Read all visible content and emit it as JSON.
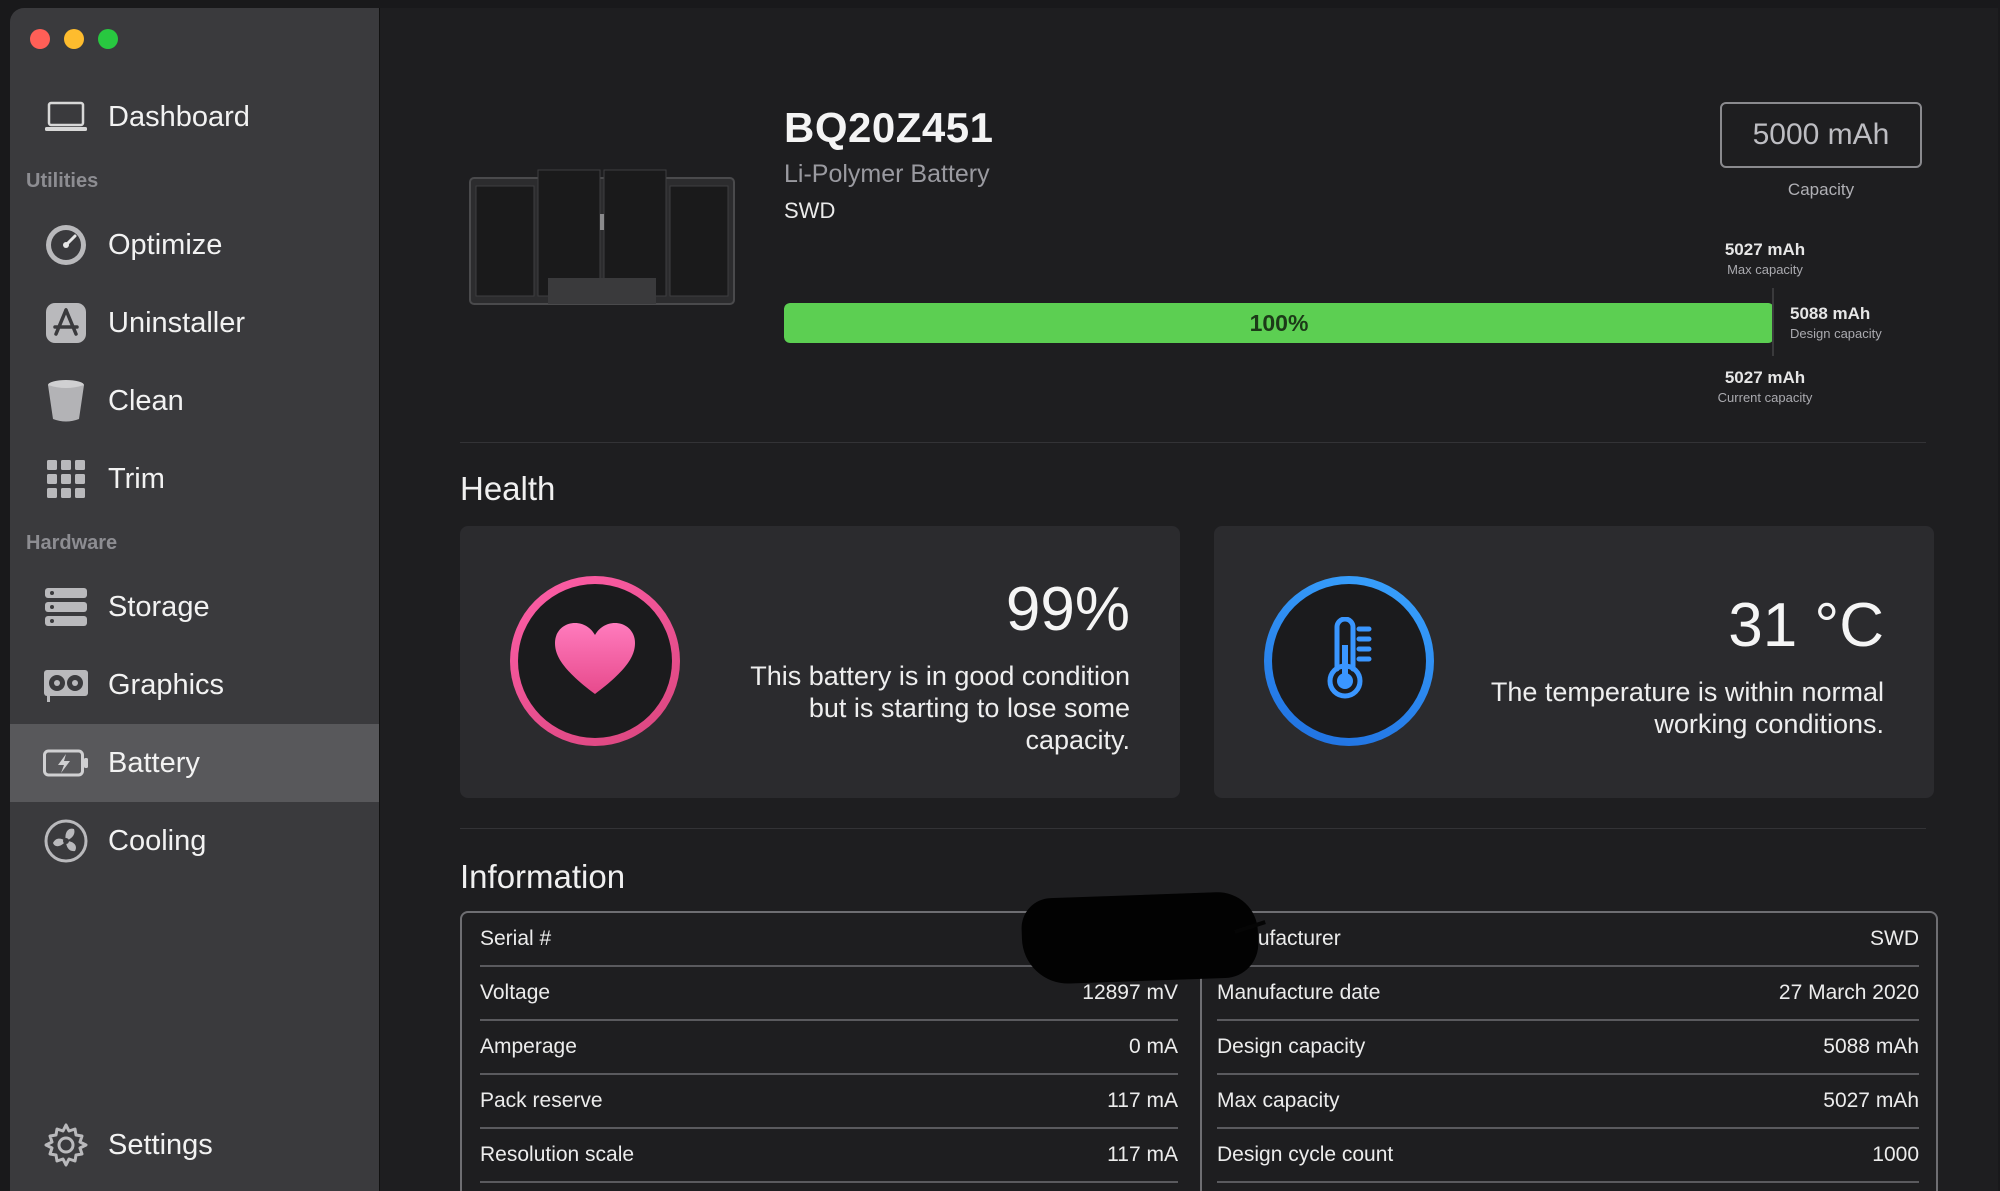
{
  "sidebar": {
    "items": [
      {
        "label": "Dashboard",
        "icon": "laptop-icon"
      },
      {
        "label": "Optimize",
        "icon": "gauge-icon"
      },
      {
        "label": "Uninstaller",
        "icon": "app-store-icon"
      },
      {
        "label": "Clean",
        "icon": "bin-icon"
      },
      {
        "label": "Trim",
        "icon": "grid-icon"
      },
      {
        "label": "Storage",
        "icon": "storage-icon"
      },
      {
        "label": "Graphics",
        "icon": "gpu-icon"
      },
      {
        "label": "Battery",
        "icon": "battery-icon"
      },
      {
        "label": "Cooling",
        "icon": "fan-icon"
      },
      {
        "label": "Settings",
        "icon": "gear-icon"
      }
    ],
    "sections": {
      "utilities": "Utilities",
      "hardware": "Hardware"
    },
    "active": "Battery"
  },
  "device": {
    "name": "BQ20Z451",
    "type": "Li-Polymer Battery",
    "manufacturer": "SWD",
    "capacity": "5000 mAh",
    "capacity_label": "Capacity"
  },
  "charge_bar": {
    "percent_label": "100%",
    "fill_fraction": 1.0,
    "fill_color": "#5ccf52",
    "max_capacity": "5027 mAh",
    "max_capacity_label": "Max capacity",
    "design_capacity": "5088 mAh",
    "design_capacity_label": "Design capacity",
    "current_capacity": "5027 mAh",
    "current_capacity_label": "Current capacity"
  },
  "health": {
    "title": "Health",
    "battery_card": {
      "value": "99%",
      "lines": [
        "This battery is in good condition",
        "but is starting to lose some",
        "capacity."
      ],
      "icon": "heart-icon",
      "accent": "#f25c9c"
    },
    "temperature_card": {
      "value": "31 °C",
      "lines": [
        "The temperature is within normal",
        "working conditions."
      ],
      "icon": "thermometer-icon",
      "accent": "#2f8cf5"
    }
  },
  "information": {
    "title": "Information",
    "left": [
      {
        "key": "Serial #",
        "value": ""
      },
      {
        "key": "Voltage",
        "value": "12897 mV"
      },
      {
        "key": "Amperage",
        "value": "0 mA"
      },
      {
        "key": "Pack reserve",
        "value": "117 mA"
      },
      {
        "key": "Resolution scale",
        "value": "117 mA"
      }
    ],
    "right": [
      {
        "key": "Manufacturer",
        "value": "SWD"
      },
      {
        "key": "Manufacture date",
        "value": "27 March 2020"
      },
      {
        "key": "Design capacity",
        "value": "5088 mAh"
      },
      {
        "key": "Max capacity",
        "value": "5027 mAh"
      },
      {
        "key": "Design cycle count",
        "value": "1000"
      }
    ]
  }
}
